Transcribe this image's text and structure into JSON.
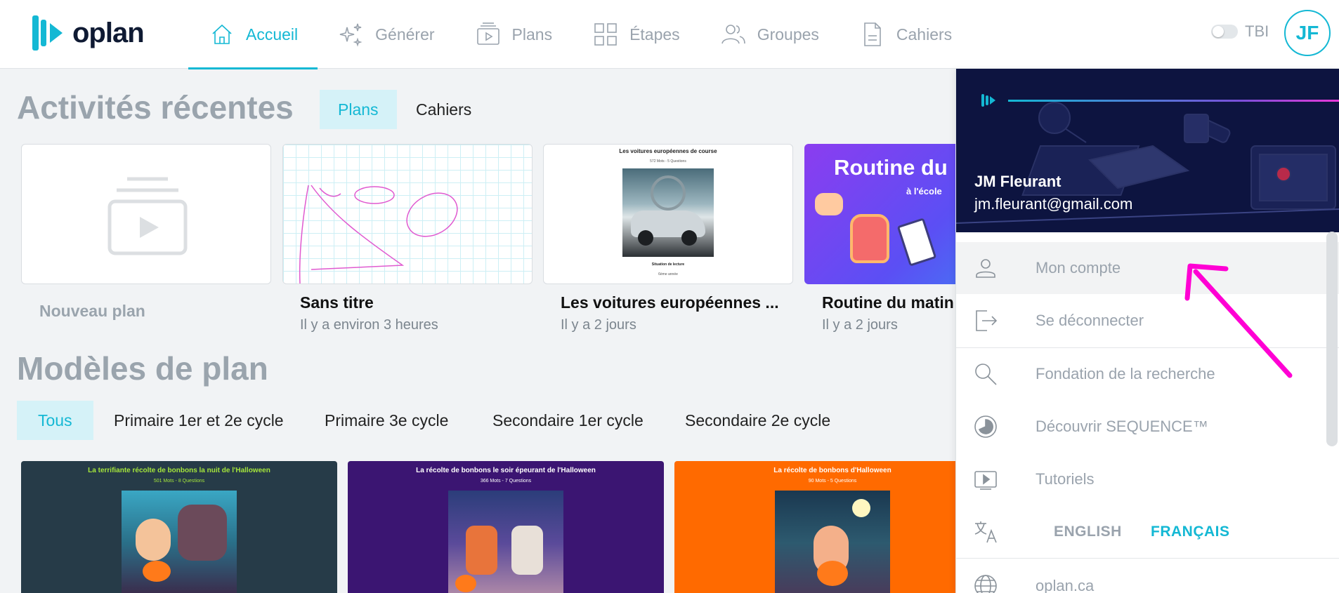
{
  "header": {
    "logo_text": "oplan",
    "nav": [
      {
        "label": "Accueil",
        "icon": "home-icon",
        "active": true
      },
      {
        "label": "Générer",
        "icon": "sparkle-icon"
      },
      {
        "label": "Plans",
        "icon": "plans-icon"
      },
      {
        "label": "Étapes",
        "icon": "grid-icon"
      },
      {
        "label": "Groupes",
        "icon": "users-icon"
      },
      {
        "label": "Cahiers",
        "icon": "document-icon"
      }
    ],
    "tbi_label": "TBI",
    "avatar_initials": "JF"
  },
  "recent": {
    "title": "Activités récentes",
    "tabs": [
      {
        "label": "Plans",
        "active": true
      },
      {
        "label": "Cahiers"
      }
    ],
    "cards": [
      {
        "title": "Nouveau plan",
        "subtitle": ""
      },
      {
        "title": "Sans titre",
        "subtitle": "Il y a environ 3 heures"
      },
      {
        "title": "Les voitures européennes ...",
        "subtitle": "Il y a 2 jours",
        "thumb_title": "Les voitures européennes de course",
        "thumb_sub": "572 Mots - 5 Questions",
        "thumb_caption": "Situation de lecture",
        "thumb_caption2": "6ème année"
      },
      {
        "title": "Routine du matin",
        "subtitle": "Il y a 2 jours",
        "thumb_title": "Routine du",
        "thumb_sub": "à l'école"
      }
    ]
  },
  "templates": {
    "title": "Modèles de plan",
    "filters": [
      {
        "label": "Tous",
        "active": true
      },
      {
        "label": "Primaire 1er et 2e cycle"
      },
      {
        "label": "Primaire 3e cycle"
      },
      {
        "label": "Secondaire 1er cycle"
      },
      {
        "label": "Secondaire 2e cycle"
      }
    ],
    "cards": [
      {
        "title": "La terrifiante récolte de bonbons la nuit de l'Halloween",
        "sub": "501 Mots - 8 Questions",
        "bg": "#263b48",
        "title_color": "#a5e63b"
      },
      {
        "title": "La récolte de bonbons le soir épeurant de l'Halloween",
        "sub": "366 Mots - 7 Questions",
        "bg": "#3b1572",
        "title_color": "#ffffff"
      },
      {
        "title": "La récolte de bonbons d'Halloween",
        "sub": "90 Mots - 5 Questions",
        "bg": "#ff6a00",
        "title_color": "#ffffff"
      }
    ]
  },
  "account_panel": {
    "name": "JM Fleurant",
    "email": "jm.fleurant@gmail.com",
    "items": [
      {
        "label": "Mon compte",
        "icon": "person-icon"
      },
      {
        "label": "Se déconnecter",
        "icon": "logout-icon"
      },
      {
        "label": "Fondation de la recherche",
        "icon": "search-icon"
      },
      {
        "label": "Découvrir SEQUENCE™",
        "icon": "sequence-icon"
      },
      {
        "label": "Tutoriels",
        "icon": "play-icon"
      },
      {
        "label": "oplan.ca",
        "icon": "globe-icon"
      }
    ],
    "languages": {
      "english": "ENGLISH",
      "french": "FRANÇAIS"
    }
  },
  "colors": {
    "accent": "#14b8d4",
    "annotation_arrow": "#ff00d4"
  }
}
